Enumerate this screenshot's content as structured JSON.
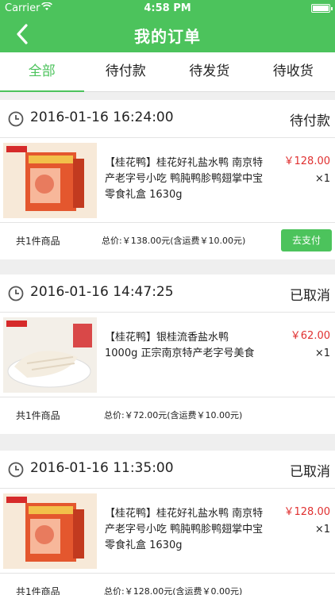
{
  "status_bar": {
    "carrier": "Carrier",
    "time": "4:58 PM"
  },
  "nav": {
    "title": "我的订单"
  },
  "tabs": [
    {
      "label": "全部",
      "active": true
    },
    {
      "label": "待付款",
      "active": false
    },
    {
      "label": "待发货",
      "active": false
    },
    {
      "label": "待收货",
      "active": false
    }
  ],
  "colors": {
    "brand": "#4cc35c",
    "price": "#e03030"
  },
  "orders": [
    {
      "date": "2016-01-16 16:24:00",
      "status": "待付款",
      "product": "【桂花鸭】桂花好礼盐水鸭 南京特产老字号小吃 鸭肫鸭胗鸭翅掌中宝零食礼盒 1630g",
      "price": "￥128.00",
      "qty": "×1",
      "count": "共1件商品",
      "total": "总价:￥138.00元(含运费￥10.00元)",
      "action": "去支付"
    },
    {
      "date": "2016-01-16 14:47:25",
      "status": "已取消",
      "product": "【桂花鸭】银桂流香盐水鸭 1000g 正宗南京特产老字号美食",
      "price": "￥62.00",
      "qty": "×1",
      "count": "共1件商品",
      "total": "总价:￥72.00元(含运费￥10.00元)"
    },
    {
      "date": "2016-01-16 11:35:00",
      "status": "已取消",
      "product": "【桂花鸭】桂花好礼盐水鸭 南京特产老字号小吃 鸭肫鸭胗鸭翅掌中宝零食礼盒 1630g",
      "price": "￥128.00",
      "qty": "×1",
      "count": "共1件商品",
      "total": "总价:￥128.00元(含运费￥0.00元)"
    }
  ]
}
